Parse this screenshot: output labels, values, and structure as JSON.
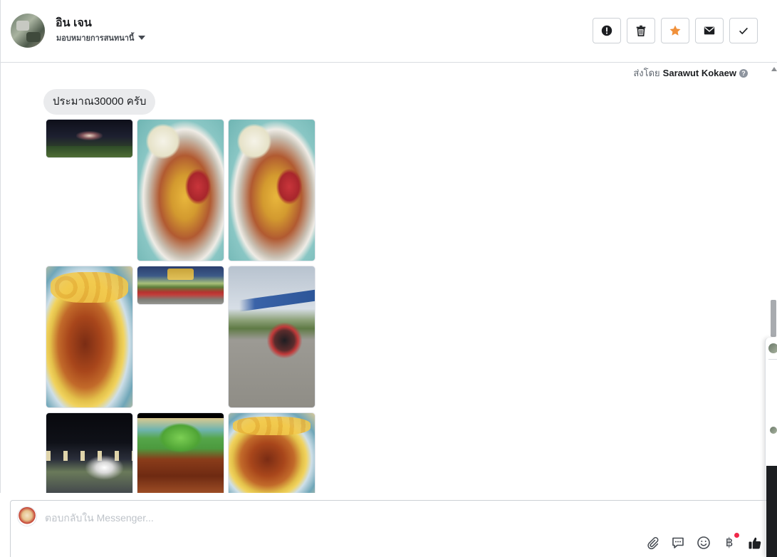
{
  "header": {
    "contact_name": "อิน เจน",
    "assign_label": "มอบหมายการสนทนานี้",
    "actions": [
      {
        "name": "spam-button",
        "icon": "alert-icon"
      },
      {
        "name": "delete-button",
        "icon": "trash-icon"
      },
      {
        "name": "star-button",
        "icon": "star-icon"
      },
      {
        "name": "mark-unread-button",
        "icon": "envelope-icon"
      },
      {
        "name": "mark-done-button",
        "icon": "check-icon"
      }
    ]
  },
  "conversation": {
    "sent_by_label": "ส่งโดย",
    "sent_by_name": "Sarawut Kokaew",
    "message_text": "ประมาณ30000 ครับ",
    "photos": [
      {
        "name": "photo-night-stall",
        "style": "night"
      },
      {
        "name": "photo-noodle-bowl",
        "style": "noodle"
      },
      {
        "name": "photo-noodle-bowl-2",
        "style": "noodle"
      },
      {
        "name": "photo-wonton-bowl",
        "style": "wonton"
      },
      {
        "name": "photo-outdoor-stall",
        "style": "stall"
      },
      {
        "name": "photo-roadside-stall",
        "style": "road"
      },
      {
        "name": "photo-night-lights",
        "style": "night2"
      },
      {
        "name": "photo-salad-plate",
        "style": "salad"
      },
      {
        "name": "photo-wonton-bowl-2",
        "style": "wonton"
      }
    ]
  },
  "composer": {
    "placeholder": "ตอบกลับใน Messenger...",
    "tools": [
      "paperclip-icon",
      "chat-bubble-icon",
      "smiley-icon",
      "baht-icon",
      "thumbs-up-icon"
    ],
    "baht_symbol": "฿"
  },
  "colors": {
    "star_accent": "#f0903a",
    "notification_dot": "#f02849",
    "bubble_bg": "#eaebed"
  }
}
